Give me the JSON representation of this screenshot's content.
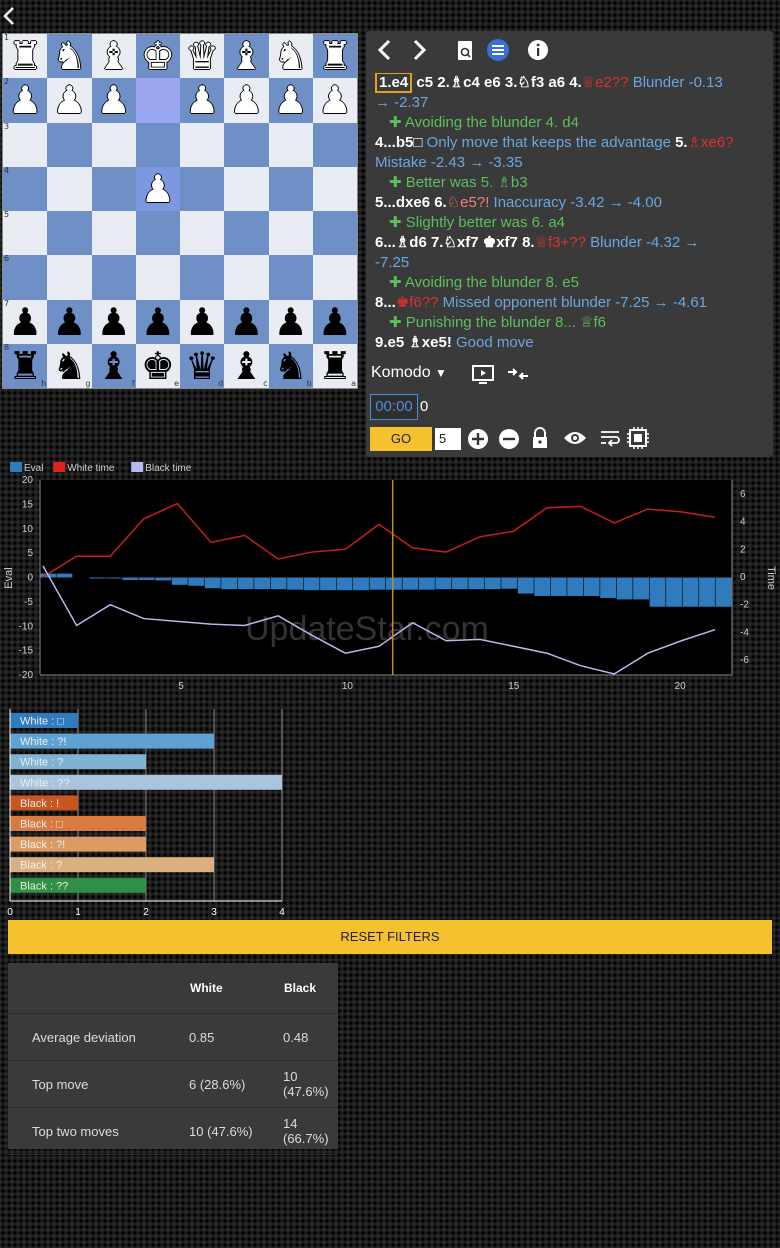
{
  "topbar": {
    "back_icon": "chevron-left-icon"
  },
  "board": {
    "rows": [
      [
        "♜",
        "♞",
        "♝",
        "♚",
        "♛",
        "♝",
        "♞",
        "♜"
      ],
      [
        "♟",
        "♟",
        "♟",
        "",
        "♟",
        "♟",
        "♟",
        "♟"
      ],
      [
        "",
        "",
        "",
        "",
        "",
        "",
        "",
        ""
      ],
      [
        "",
        "",
        "",
        "♟",
        "",
        "",
        "",
        ""
      ],
      [
        "",
        "",
        "",
        "",
        "",
        "",
        "",
        ""
      ],
      [
        "",
        "",
        "",
        "",
        "",
        "",
        "",
        ""
      ],
      [
        "♟",
        "♟",
        "♟",
        "♟",
        "♟",
        "♟",
        "♟",
        "♟"
      ],
      [
        "♜",
        "♞",
        "♝",
        "♚",
        "♛",
        "♝",
        "♞",
        "♜"
      ]
    ],
    "rank_labels": [
      "1",
      "2",
      "3",
      "4",
      "5",
      "6",
      "7",
      "8"
    ],
    "file_labels": [
      "h",
      "g",
      "f",
      "e",
      "d",
      "c",
      "b",
      "a"
    ]
  },
  "toolbar": {
    "icons": [
      "chevron-left-icon",
      "chevron-right-icon",
      "search-document-icon",
      "list-icon",
      "info-icon"
    ]
  },
  "moves": {
    "l1_move1": "1.e4",
    "l1_rest": " c5 2.♗c4 e6 3.♘f3 a6 4.",
    "l1_blunder": "♕e2??",
    "l1_comment": " Blunder -0.13",
    "l2": "→ -2.37",
    "l3_text": "Avoiding the blunder ",
    "l3_move": "4. d4",
    "l4_move": "4...b5□",
    "l4_comment": " Only move that keeps the advantage ",
    "l4_move2": "5.",
    "l4_mistake": "♗xe6?",
    "l5": "Mistake -2.43 → -3.35",
    "l6_text": "Better was ",
    "l6_move": "5. ♗b3",
    "l7_move": "5...dxe6 6.",
    "l7_inacc": "♘e5?!",
    "l7_comment": " Inaccuracy -3.42 → -4.00",
    "l8_text": "Slightly better was ",
    "l8_move": "6. a4",
    "l9_move": "6...♗d6 7.♘xf7 ♚xf7 8.",
    "l9_blunder": "♕f3+??",
    "l9_comment": " Blunder -4.32 →",
    "l10": "-7.25",
    "l11_text": "Avoiding the blunder ",
    "l11_move": "8. e5",
    "l12_move": "8...",
    "l12_blunder": "♚f6??",
    "l12_comment": " Missed opponent blunder -7.25 → -4.61",
    "l13_text": "Punishing the blunder ",
    "l13_move": "8... ♕f6",
    "l14_move": "9.e5 ♗xe5!",
    "l14_comment": " Good move"
  },
  "engine": {
    "name": "Komodo",
    "timer": "00:00",
    "count": "0",
    "go_label": "GO",
    "depth": "5"
  },
  "chart_data": {
    "type": "bar",
    "legend": [
      "Eval",
      "White time",
      "Black time"
    ],
    "xlabel": "",
    "ylabel": "Eval",
    "y2label": "Time",
    "x_ticks": [
      5,
      10,
      15,
      20
    ],
    "y_ticks": [
      20,
      15,
      10,
      5,
      0,
      -5,
      -10,
      -15,
      -20
    ],
    "y2_ticks": [
      6,
      4,
      2,
      0,
      -2,
      -4,
      -6
    ],
    "eval": [
      0.8,
      0.8,
      0,
      -0.2,
      -0.2,
      -0.5,
      -0.5,
      -0.6,
      -1.5,
      -1.7,
      -2.2,
      -2.4,
      -2.4,
      -2.4,
      -2.4,
      -2.5,
      -2.6,
      -2.6,
      -2.6,
      -2.6,
      -2.5,
      -2.5,
      -2.5,
      -2.5,
      -2.4,
      -2.4,
      -2.4,
      -2.4,
      -2.3,
      -3.3,
      -3.8,
      -3.8,
      -3.8,
      -3.8,
      -4.2,
      -4.5,
      -4.5,
      -6.0,
      -6.0,
      -6.0,
      -6.0,
      -6.0
    ],
    "white_time": [
      0,
      1.5,
      1.5,
      4.2,
      5.3,
      2.5,
      3.0,
      1.3,
      1.8,
      2.0,
      3.8,
      2.1,
      1.8,
      2.9,
      3.3,
      5.0,
      5.1,
      3.9,
      4.9,
      4.7,
      4.3
    ],
    "black_time": [
      0.8,
      -3.5,
      -2.0,
      -3.0,
      -3.2,
      -3.4,
      -3.5,
      -2.8,
      -4.2,
      -5.5,
      -5.0,
      -3.3,
      -4.6,
      -4.5,
      -5.0,
      -5.5,
      -6.4,
      -7.0,
      -5.5,
      -4.6,
      -3.8
    ],
    "cursor_x": 11.5,
    "watermark": "UpdateStar.com"
  },
  "bars": {
    "labels": [
      "White : □",
      "White : ?!",
      "White : ?",
      "White : ??",
      "Black : !",
      "Black : □",
      "Black : ?!",
      "Black : ?",
      "Black : ??"
    ],
    "values": [
      1,
      3,
      2,
      4,
      1,
      2,
      2,
      3,
      2
    ],
    "colors": [
      "#2f7bbd",
      "#5ea2d4",
      "#7eb3d4",
      "#a9c4dc",
      "#c8561e",
      "#d97b3f",
      "#dc9b65",
      "#d9b07e",
      "#2e8f45"
    ],
    "x_ticks": [
      "0",
      "1",
      "2",
      "3",
      "4"
    ]
  },
  "reset_label": "RESET FILTERS",
  "stats": {
    "head": [
      "",
      "White",
      "Black"
    ],
    "rows": [
      [
        "Average deviation",
        "0.85",
        "0.48"
      ],
      [
        "Top move",
        "6 (28.6%)",
        "10 (47.6%)"
      ],
      [
        "Top two moves",
        "10 (47.6%)",
        "14 (66.7%)"
      ]
    ]
  }
}
